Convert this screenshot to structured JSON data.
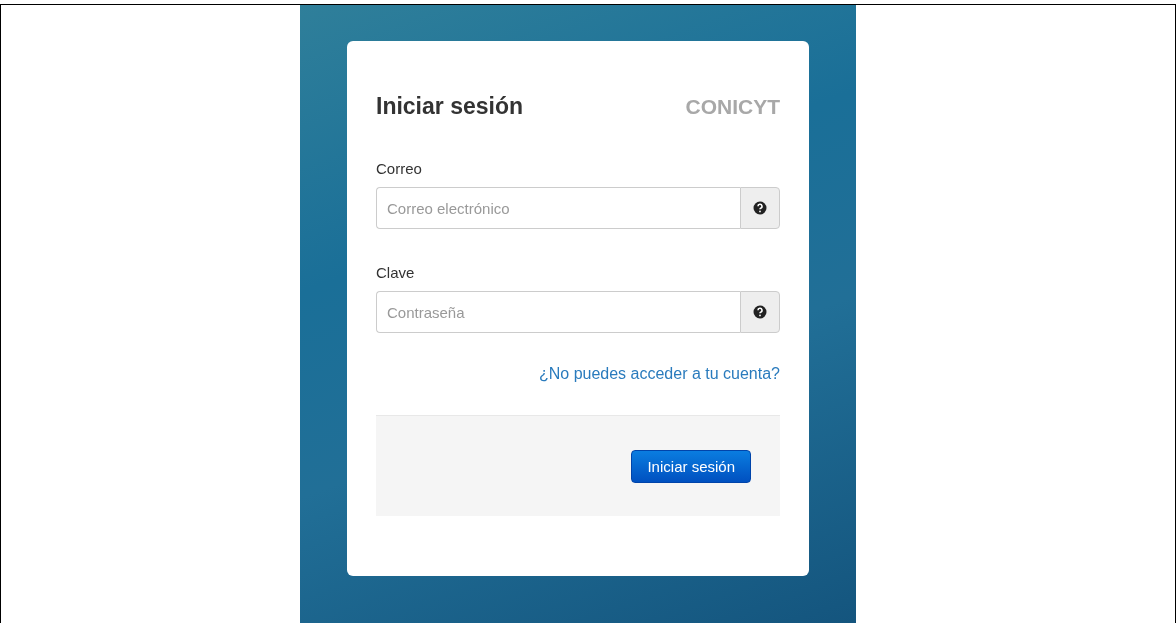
{
  "login": {
    "title": "Iniciar sesión",
    "brand": "CONICYT",
    "fields": [
      {
        "label": "Correo",
        "placeholder": "Correo electrónico"
      },
      {
        "label": "Clave",
        "placeholder": "Contraseña"
      }
    ],
    "forgot_link": "¿No puedes acceder a tu cuenta?",
    "submit": "Iniciar sesión"
  }
}
